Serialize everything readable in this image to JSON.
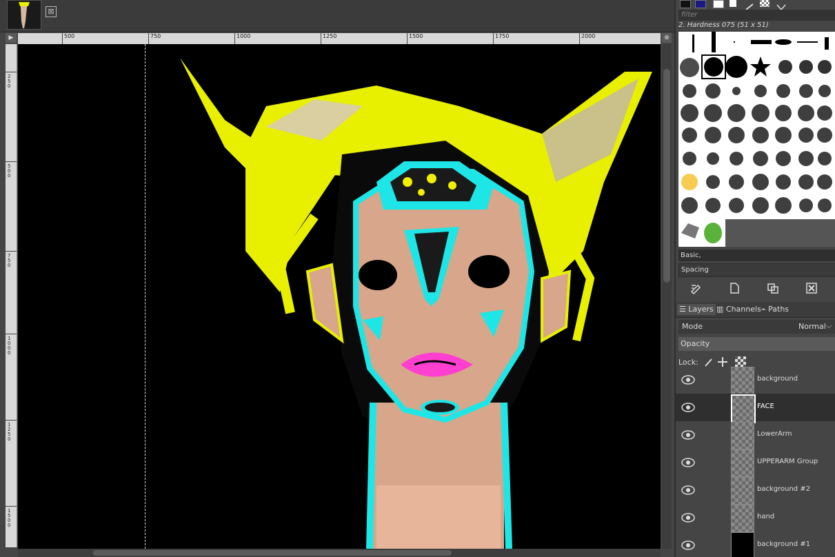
{
  "colors": {
    "hair_yellow": "#e8f000",
    "cyan_outline": "#1fe6e6",
    "lip_pink": "#ff3fd0",
    "skin": "#d8a68a",
    "canvas_bg": "#000000",
    "dock_bg": "#454545"
  },
  "image_tab": {
    "close_icon": "close-icon",
    "close_glyph": "⊠"
  },
  "ruler": {
    "corner_glyph": "▶",
    "nav_glyph": "⊕",
    "h_labels": [
      "500",
      "750",
      "1000",
      "1250",
      "1500",
      "1750",
      "2000"
    ],
    "v_labels": [
      "250",
      "500",
      "750",
      "1000",
      "1250",
      "1500"
    ]
  },
  "brushes": {
    "filter_placeholder": "filter",
    "selected_brush": "2. Hardness 075 (51 x 51)",
    "tags_value": "Basic,",
    "spacing_label": "Spacing"
  },
  "dock_buttons": [
    "edit-brush-icon",
    "new-brush-icon",
    "duplicate-brush-icon",
    "delete-brush-icon"
  ],
  "layers_panel": {
    "tabs": [
      {
        "label": "Layers",
        "icon": "layers-icon"
      },
      {
        "label": "Channels",
        "icon": "channels-icon"
      },
      {
        "label": "Paths",
        "icon": "paths-icon"
      }
    ],
    "mode_label": "Mode",
    "mode_value": "Normal",
    "opacity_label": "Opacity",
    "lock_label": "Lock:",
    "layers": [
      {
        "name": "background",
        "visible": true,
        "selected": false
      },
      {
        "name": "FACE",
        "visible": true,
        "selected": true
      },
      {
        "name": "LowerArm",
        "visible": true,
        "selected": false
      },
      {
        "name": "UPPERARM Group",
        "visible": true,
        "selected": false
      },
      {
        "name": "background #2",
        "visible": true,
        "selected": false
      },
      {
        "name": "hand",
        "visible": true,
        "selected": false
      },
      {
        "name": "background #1",
        "visible": true,
        "selected": false
      }
    ]
  }
}
